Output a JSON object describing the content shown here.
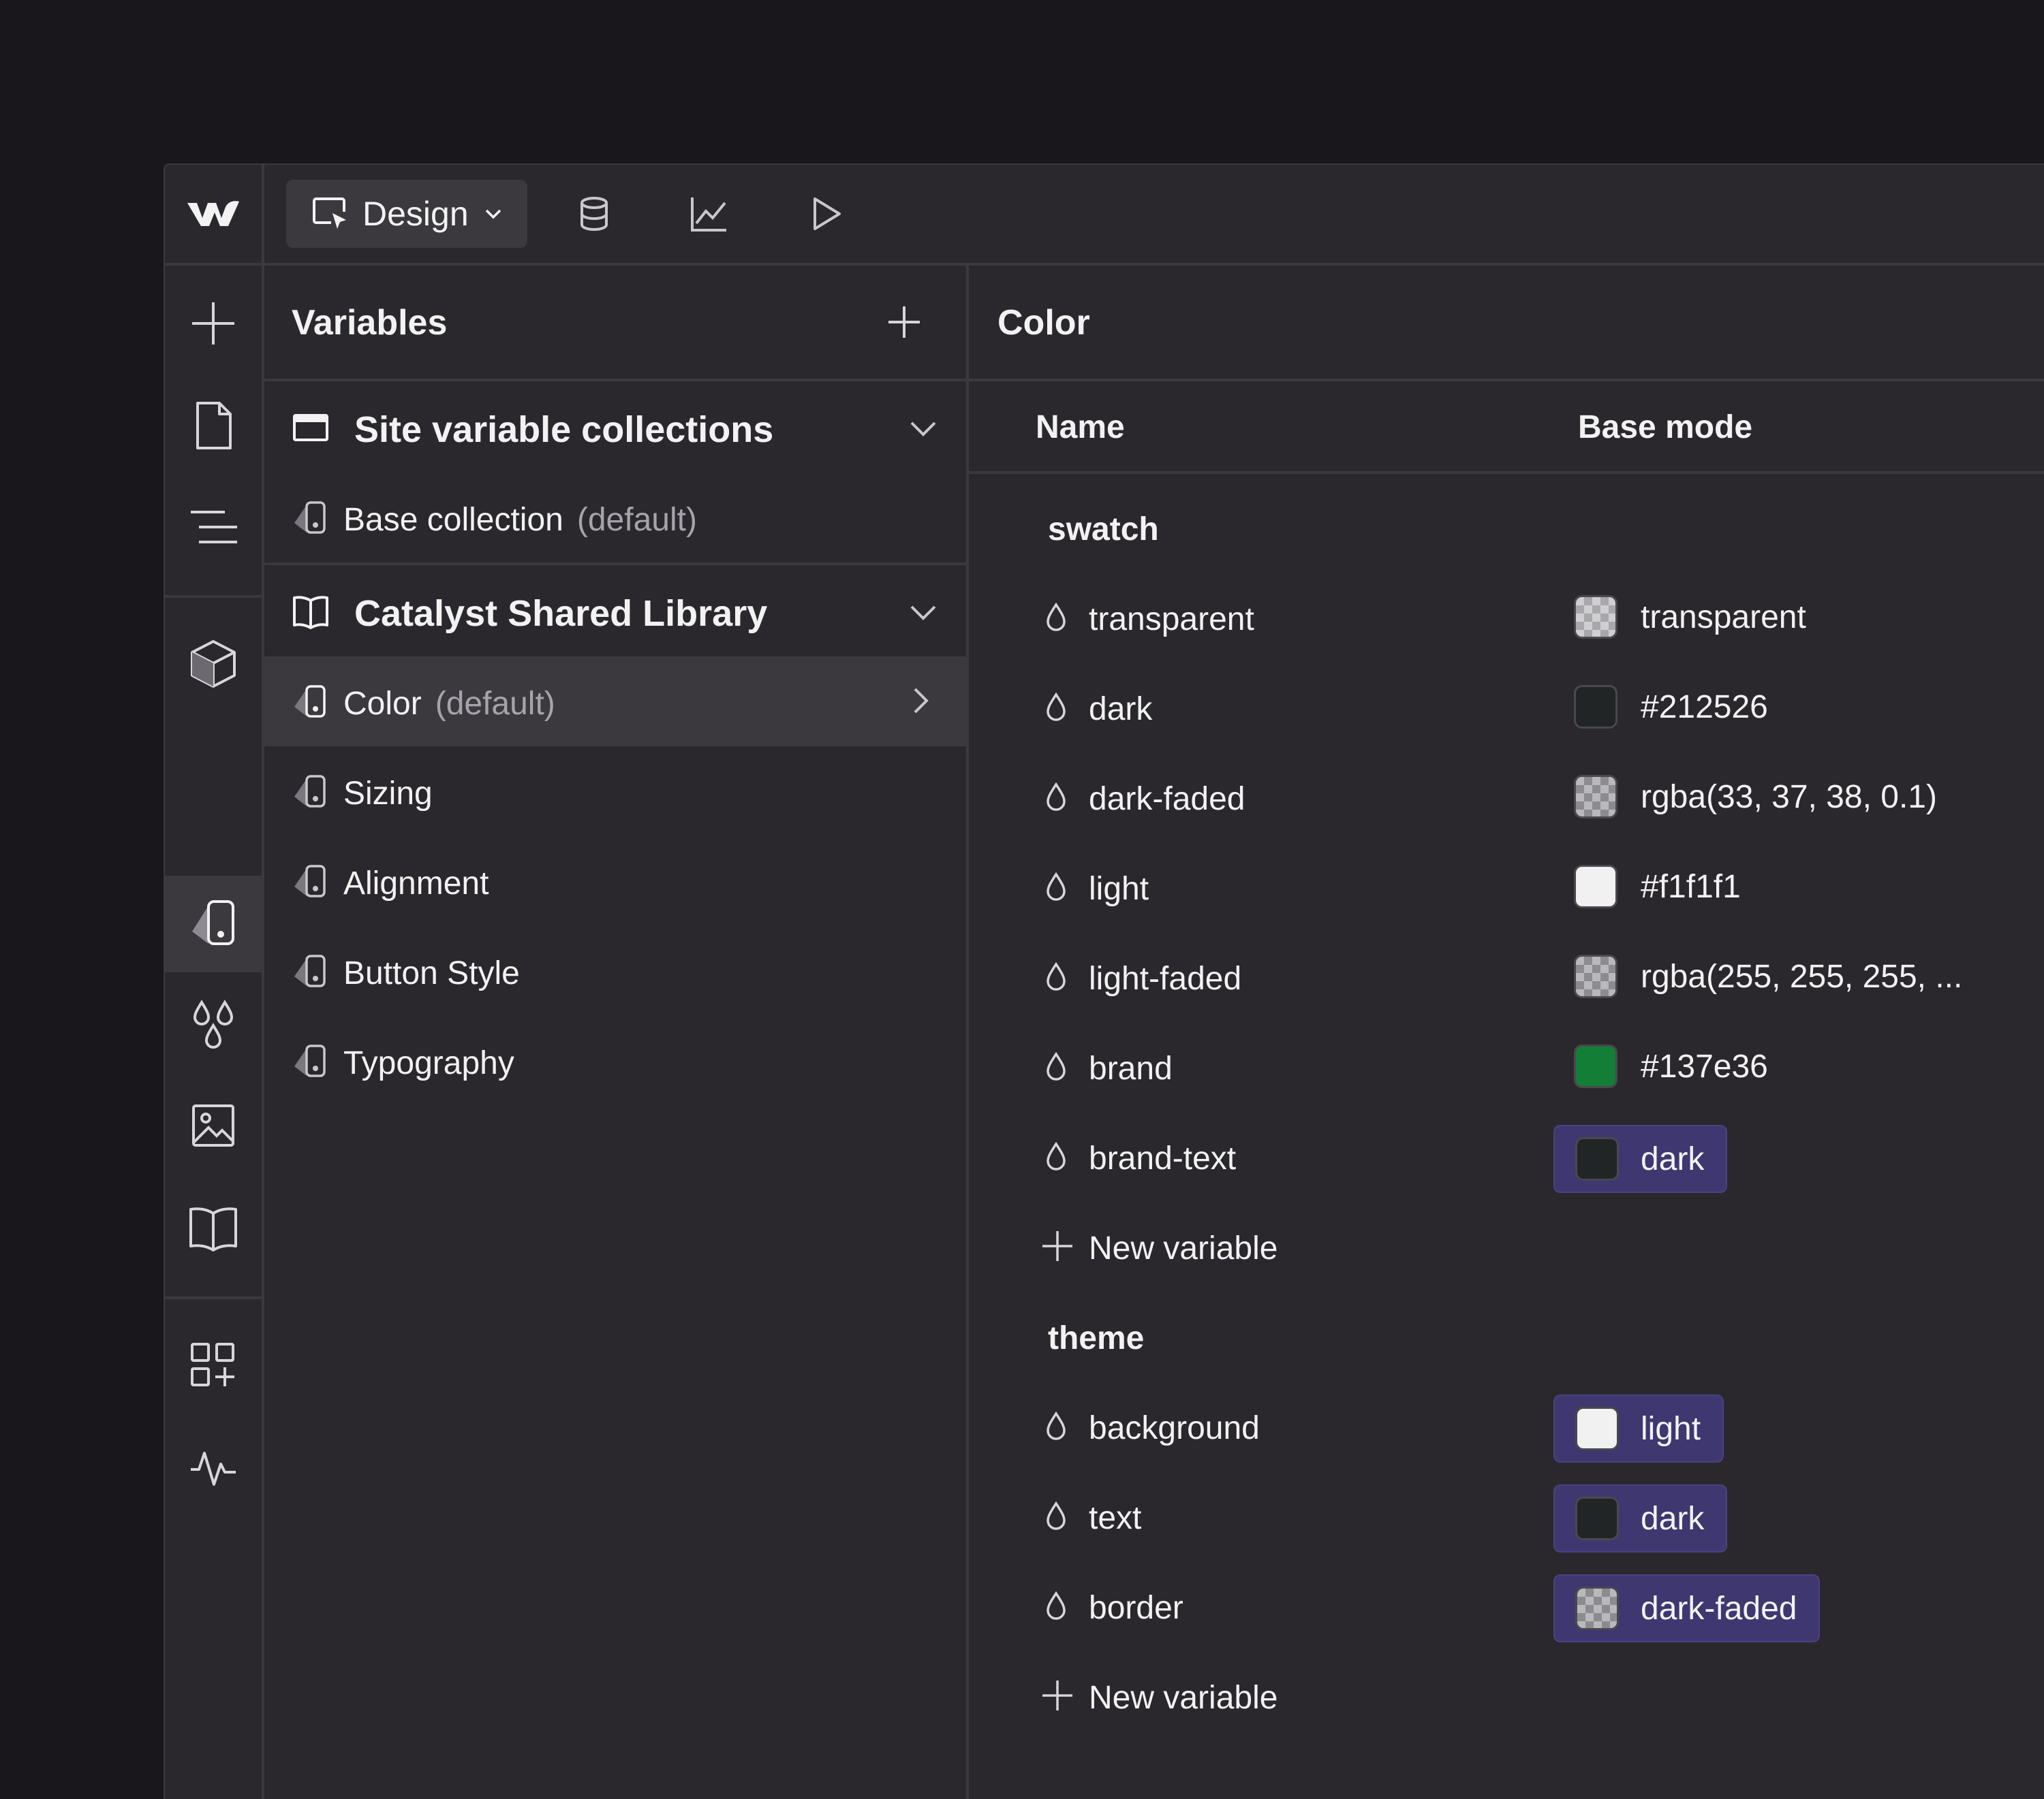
{
  "toolbar": {
    "mode_label": "Design"
  },
  "variables_panel": {
    "title": "Variables",
    "sections": [
      {
        "title": "Site variable collections",
        "items": [
          {
            "label": "Base collection",
            "suffix": "(default)"
          }
        ]
      },
      {
        "title": "Catalyst Shared Library",
        "items": [
          {
            "label": "Color",
            "suffix": "(default)",
            "active": true
          },
          {
            "label": "Sizing",
            "suffix": ""
          },
          {
            "label": "Alignment",
            "suffix": ""
          },
          {
            "label": "Button Style",
            "suffix": ""
          },
          {
            "label": "Typography",
            "suffix": ""
          }
        ]
      }
    ]
  },
  "main": {
    "title": "Color",
    "col_name": "Name",
    "col_mode": "Base mode",
    "new_variable_label": "New variable",
    "groups": [
      {
        "name": "swatch",
        "variables": [
          {
            "name": "transparent",
            "value": "transparent",
            "swatch": "transparent",
            "alias": false
          },
          {
            "name": "dark",
            "value": "#212526",
            "swatch": "#212526",
            "alias": false
          },
          {
            "name": "dark-faded",
            "value": "rgba(33, 37, 38, 0.1)",
            "swatch": "checker",
            "alias": false
          },
          {
            "name": "light",
            "value": "#f1f1f1",
            "swatch": "#f1f1f1",
            "alias": false
          },
          {
            "name": "light-faded",
            "value": "rgba(255, 255, 255, ...",
            "swatch": "checker",
            "alias": false
          },
          {
            "name": "brand",
            "value": "#137e36",
            "swatch": "#137e36",
            "alias": false
          },
          {
            "name": "brand-text",
            "value": "dark",
            "swatch": "#212526",
            "alias": true
          }
        ]
      },
      {
        "name": "theme",
        "variables": [
          {
            "name": "background",
            "value": "light",
            "swatch": "#f1f1f1",
            "alias": true
          },
          {
            "name": "text",
            "value": "dark",
            "swatch": "#212526",
            "alias": true
          },
          {
            "name": "border",
            "value": "dark-faded",
            "swatch": "checker",
            "alias": true
          }
        ]
      }
    ]
  },
  "colors": {
    "background": "#19171c",
    "surface": "#2a282d",
    "border": "#3b393e",
    "alias_pill": "#3e3770",
    "brand": "#137e36"
  }
}
